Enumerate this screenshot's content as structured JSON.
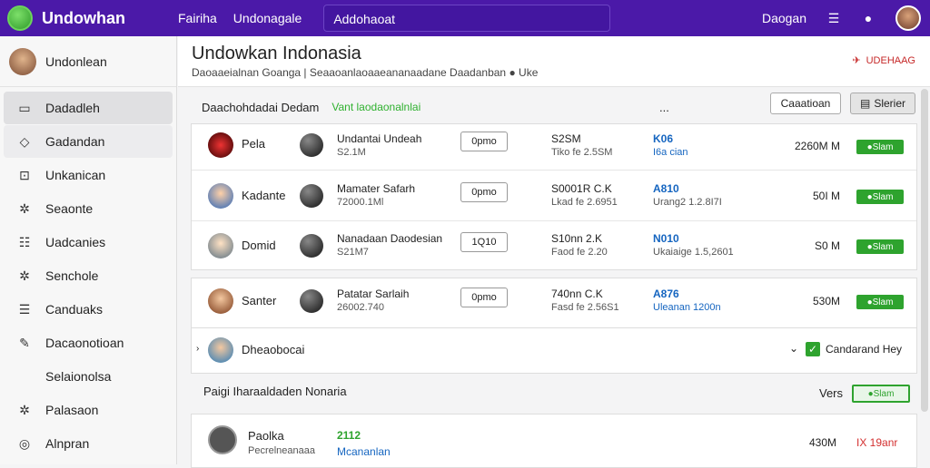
{
  "topbar": {
    "brand": "Undowhan",
    "nav": [
      "Fairiha",
      "Undonagale"
    ],
    "search": "Addohaoat",
    "action": "Daogan"
  },
  "sidebar": {
    "user": "Undonlean",
    "items": [
      {
        "label": "Dadadleh",
        "icon": "document-icon"
      },
      {
        "label": "Gadandan",
        "icon": "chat-icon"
      },
      {
        "label": "Unkanican",
        "icon": "inbox-icon"
      },
      {
        "label": "Seaonte",
        "icon": "gear-icon"
      },
      {
        "label": "Uadcanies",
        "icon": "list-icon"
      },
      {
        "label": "Senchole",
        "icon": "gear-icon"
      },
      {
        "label": "Canduaks",
        "icon": "table-icon"
      },
      {
        "label": "Dacaonotioan",
        "icon": "edit-icon"
      },
      {
        "label": "Selaionolsa",
        "icon": ""
      },
      {
        "label": "Palasaon",
        "icon": "gear-icon"
      },
      {
        "label": "Alnpran",
        "icon": "help-icon"
      }
    ]
  },
  "header": {
    "title": "Undowkan Indonasia",
    "subtitle": "Daoaaeialnan Goanga | Seaaoanlaoaaeananaadane Daadanban",
    "subtitle_tag": "Uke",
    "badge": "UDEHAAG"
  },
  "toolbar": {
    "label": "Daachohdadai Dedam",
    "link": "Vant laodaonalnlai",
    "dots": "...",
    "btn1": "Caaatioan",
    "btn2": "Slerier"
  },
  "rows": [
    {
      "name": "Pela",
      "t1": "Undantai Undeah",
      "t2": "S2.1M",
      "pill": "0pmo",
      "p1": "S2SM",
      "p2": "Tiko fe 2.5SM",
      "b1": "K06",
      "b2": "I6a cian",
      "size": "2260M M",
      "btn": "Slam"
    },
    {
      "name": "Kadante",
      "t1": "Mamater Safarh",
      "t2": "72000.1Ml",
      "pill": "0pmo",
      "p1": "S0001R C.K",
      "p2": "Lkad fe 2.6951",
      "b1": "A810",
      "b2": "Urang2 1.2.8I7I",
      "size": "50I M",
      "btn": "Slam"
    },
    {
      "name": "Domid",
      "t1": "Nanadaan Daodesian",
      "t2": "S21M7",
      "pill": "1Q10",
      "p1": "S10nn 2.K",
      "p2": "Faod fe 2.20",
      "b1": "N010",
      "b2": "Ukaiaige 1.5,2601",
      "size": "S0 M",
      "btn": "Slam"
    },
    {
      "name": "Santer",
      "t1": "Patatar Sarlaih",
      "t2": "26002.740",
      "pill": "0pmo",
      "p1": "740nn C.K",
      "p2": "Fasd fe 2.56S1",
      "b1": "A876",
      "b2": "Uleanan 1200n",
      "size": "530M",
      "btn": "Slam"
    }
  ],
  "group": {
    "label": "Dheaobocai",
    "check_label": "Candarand Hey"
  },
  "section": {
    "label": "Paigi Iharaaldaden Nonaria",
    "vers": "Vers",
    "vbtn": "Slam"
  },
  "last": {
    "name": "Paolka",
    "sub": "Pecrelneanaaa",
    "v1": "2112",
    "v2": "Mcananlan",
    "size": "430M",
    "red": "IX 19anr"
  }
}
